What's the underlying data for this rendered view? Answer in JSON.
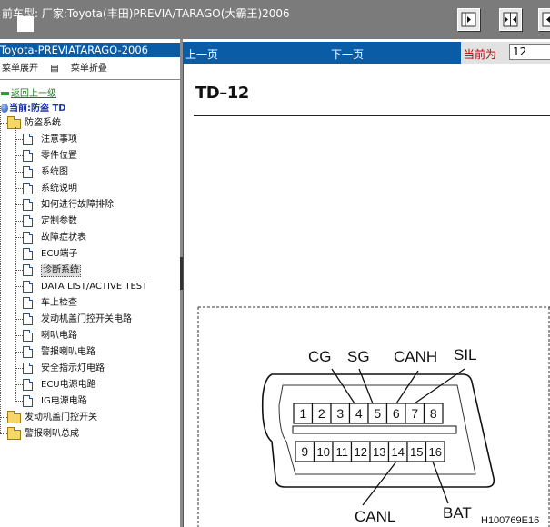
{
  "topbar": {
    "title": "前车型:   厂家:Toyota(丰田)PREVIA/TARAGO(大霸王)2006",
    "buttons": [
      "panel-right-icon",
      "panel-split-icon",
      "panel-left-icon"
    ]
  },
  "left": {
    "header": "Toyota-PREVIATARAGO-2006",
    "expand_label": "菜单展开",
    "collapse_label": "菜单折叠",
    "back_label": "返回上一级",
    "current_label": "当前:防盗 TD",
    "tree": [
      {
        "label": "防盗系统",
        "type": "folder",
        "level": 1
      },
      {
        "label": "注意事项",
        "type": "doc",
        "level": 2
      },
      {
        "label": "零件位置",
        "type": "doc",
        "level": 2
      },
      {
        "label": "系统图",
        "type": "doc",
        "level": 2
      },
      {
        "label": "系统说明",
        "type": "doc",
        "level": 2
      },
      {
        "label": "如何进行故障排除",
        "type": "doc",
        "level": 2
      },
      {
        "label": "定制参数",
        "type": "doc",
        "level": 2
      },
      {
        "label": "故障症状表",
        "type": "doc",
        "level": 2
      },
      {
        "label": "ECU端子",
        "type": "doc",
        "level": 2
      },
      {
        "label": "诊断系统",
        "type": "doc",
        "level": 2,
        "selected": true
      },
      {
        "label": "DATA LIST/ACTIVE TEST",
        "type": "doc",
        "level": 2
      },
      {
        "label": "车上检查",
        "type": "doc",
        "level": 2
      },
      {
        "label": "发动机盖门控开关电路",
        "type": "doc",
        "level": 2
      },
      {
        "label": "喇叭电路",
        "type": "doc",
        "level": 2
      },
      {
        "label": "警报喇叭电路",
        "type": "doc",
        "level": 2
      },
      {
        "label": "安全指示灯电路",
        "type": "doc",
        "level": 2
      },
      {
        "label": "ECU电源电路",
        "type": "doc",
        "level": 2
      },
      {
        "label": "IG电源电路",
        "type": "doc",
        "level": 2
      },
      {
        "label": "发动机盖门控开关",
        "type": "folder",
        "level": 1
      },
      {
        "label": "警报喇叭总成",
        "type": "folder",
        "level": 1
      }
    ]
  },
  "nav": {
    "prev": "上一页",
    "next": "下一页",
    "current_label": "当前为",
    "current_value": "12"
  },
  "doc": {
    "page_id": "TD–12",
    "diagram": {
      "labels_top": [
        "CG",
        "SG",
        "CANH",
        "SIL"
      ],
      "labels_bottom": [
        "CANL",
        "BAT"
      ],
      "pins_top": [
        "1",
        "2",
        "3",
        "4",
        "5",
        "6",
        "7",
        "8"
      ],
      "pins_bottom": [
        "9",
        "10",
        "11",
        "12",
        "13",
        "14",
        "15",
        "16"
      ],
      "figure_code": "H100769E16"
    }
  }
}
